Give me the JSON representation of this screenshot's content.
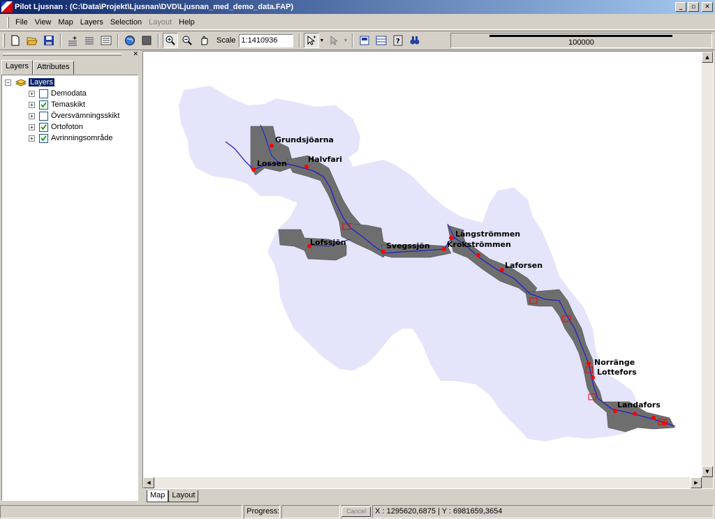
{
  "window": {
    "title": "Pilot Ljusnan : (C:\\Data\\Projekt\\Ljusnan\\DVD\\Ljusnan_med_demo_data.FAP)",
    "minimize": "_",
    "restore": "▫",
    "close": "✕"
  },
  "menu": {
    "items": [
      "File",
      "View",
      "Map",
      "Layers",
      "Selection",
      "Layout",
      "Help"
    ],
    "disabled": [
      "Layout"
    ]
  },
  "toolbar": {
    "scale_label": "Scale",
    "scale_value": "1:1410936",
    "scalebar_text": "100000"
  },
  "panel": {
    "close": "✕",
    "tabs": [
      "Layers",
      "Attributes"
    ],
    "root_label": "Layers",
    "layers": [
      {
        "name": "Demodata",
        "checked": false
      },
      {
        "name": "Temaskikt",
        "checked": true
      },
      {
        "name": "Översvämningsskikt",
        "checked": false
      },
      {
        "name": "Ortofoton",
        "checked": true
      },
      {
        "name": "Avrinningsområde",
        "checked": true
      }
    ]
  },
  "map": {
    "labels": [
      "Grundsjöarna",
      "Halvfari",
      "Lossen",
      "Lofssjön",
      "Svegssjön",
      "Långströmmen",
      "Krokströmmen",
      "Laforsen",
      "Norränge",
      "Lottefors",
      "Landafors"
    ],
    "catchment_color": "#e4e4fb",
    "river_color": "#2020cc",
    "point_color": "#ff0000"
  },
  "bottom_tabs": [
    "Map",
    "Layout"
  ],
  "status": {
    "progress_label": "Progress:",
    "cancel_label": "Cancel",
    "coords": "X : 1295620,6875 | Y : 6981659,3654"
  }
}
